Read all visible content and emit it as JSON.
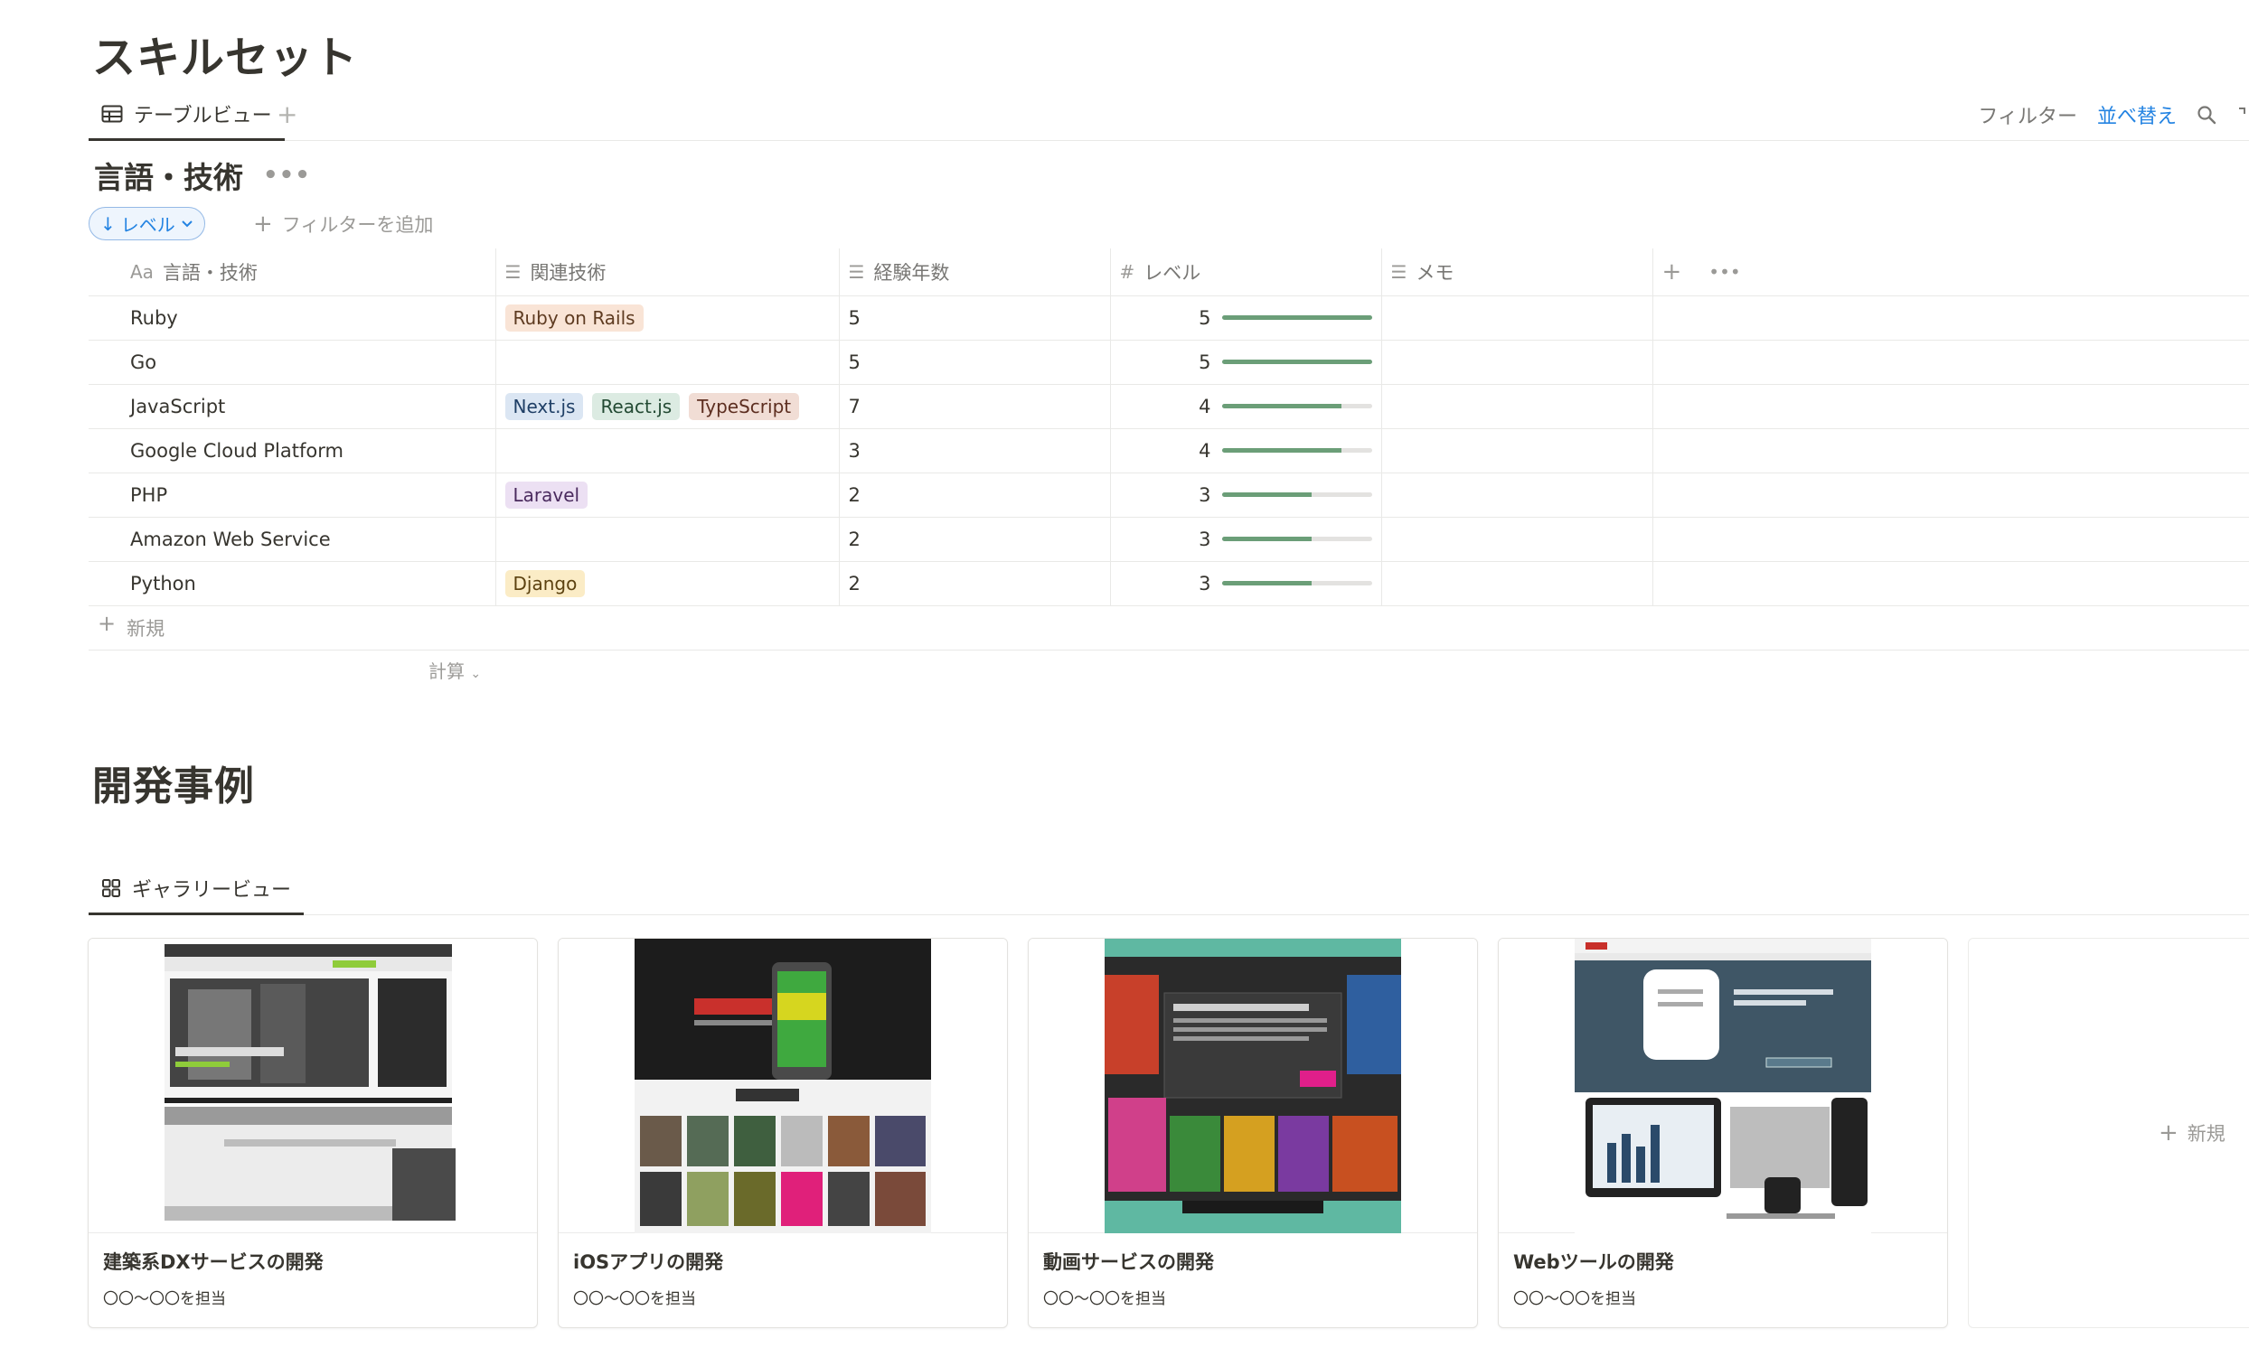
{
  "page_title": "スキルセット",
  "skill_view": {
    "tab_label": "テーブルビュー"
  },
  "toolbar": {
    "filter": "フィルター",
    "sort": "並べ替え"
  },
  "database": {
    "title": "言語・技術",
    "sort_chip": "レベル",
    "add_filter": "フィルターを追加",
    "columns": {
      "name": "言語・技術",
      "related": "関連技術",
      "years": "経験年数",
      "level": "レベル",
      "memo": "メモ"
    },
    "rows": [
      {
        "name": "Ruby",
        "tags": [
          {
            "label": "Ruby on Rails",
            "bg": "#f9e4d6",
            "fg": "#5e3b21"
          }
        ],
        "years": "5",
        "level": "5",
        "level_fraction": 1.0
      },
      {
        "name": "Go",
        "tags": [],
        "years": "5",
        "level": "5",
        "level_fraction": 1.0
      },
      {
        "name": "JavaScript",
        "tags": [
          {
            "label": "Next.js",
            "bg": "#dbe6f3",
            "fg": "#1f3f66"
          },
          {
            "label": "React.js",
            "bg": "#dcebe2",
            "fg": "#234a33"
          },
          {
            "label": "TypeScript",
            "bg": "#f1ddd5",
            "fg": "#5d2e20"
          }
        ],
        "years": "7",
        "level": "4",
        "level_fraction": 0.8
      },
      {
        "name": "Google Cloud Platform",
        "tags": [],
        "years": "3",
        "level": "4",
        "level_fraction": 0.8
      },
      {
        "name": "PHP",
        "tags": [
          {
            "label": "Laravel",
            "bg": "#ece0f3",
            "fg": "#4a2a5e"
          }
        ],
        "years": "2",
        "level": "3",
        "level_fraction": 0.6
      },
      {
        "name": "Amazon Web Service",
        "tags": [],
        "years": "2",
        "level": "3",
        "level_fraction": 0.6
      },
      {
        "name": "Python",
        "tags": [
          {
            "label": "Django",
            "bg": "#fbecc6",
            "fg": "#5c4210"
          }
        ],
        "years": "2",
        "level": "3",
        "level_fraction": 0.6
      }
    ],
    "new_row": "新規",
    "calculate": "計算"
  },
  "gallery_section": {
    "title": "開発事例",
    "tab_label": "ギャラリービュー",
    "new_label": "新規",
    "cards": [
      {
        "title": "建築系DXサービスの開発",
        "subtitle": "〇〇〜〇〇を担当",
        "image_icon": "laptop-image-icon"
      },
      {
        "title": "iOSアプリの開発",
        "subtitle": "〇〇〜〇〇を担当",
        "image_icon": "mobile-apps-image-icon"
      },
      {
        "title": "動画サービスの開発",
        "subtitle": "〇〇〜〇〇を担当",
        "image_icon": "video-service-image-icon"
      },
      {
        "title": "Webツールの開発",
        "subtitle": "〇〇〜〇〇を担当",
        "image_icon": "devices-image-icon"
      }
    ]
  }
}
